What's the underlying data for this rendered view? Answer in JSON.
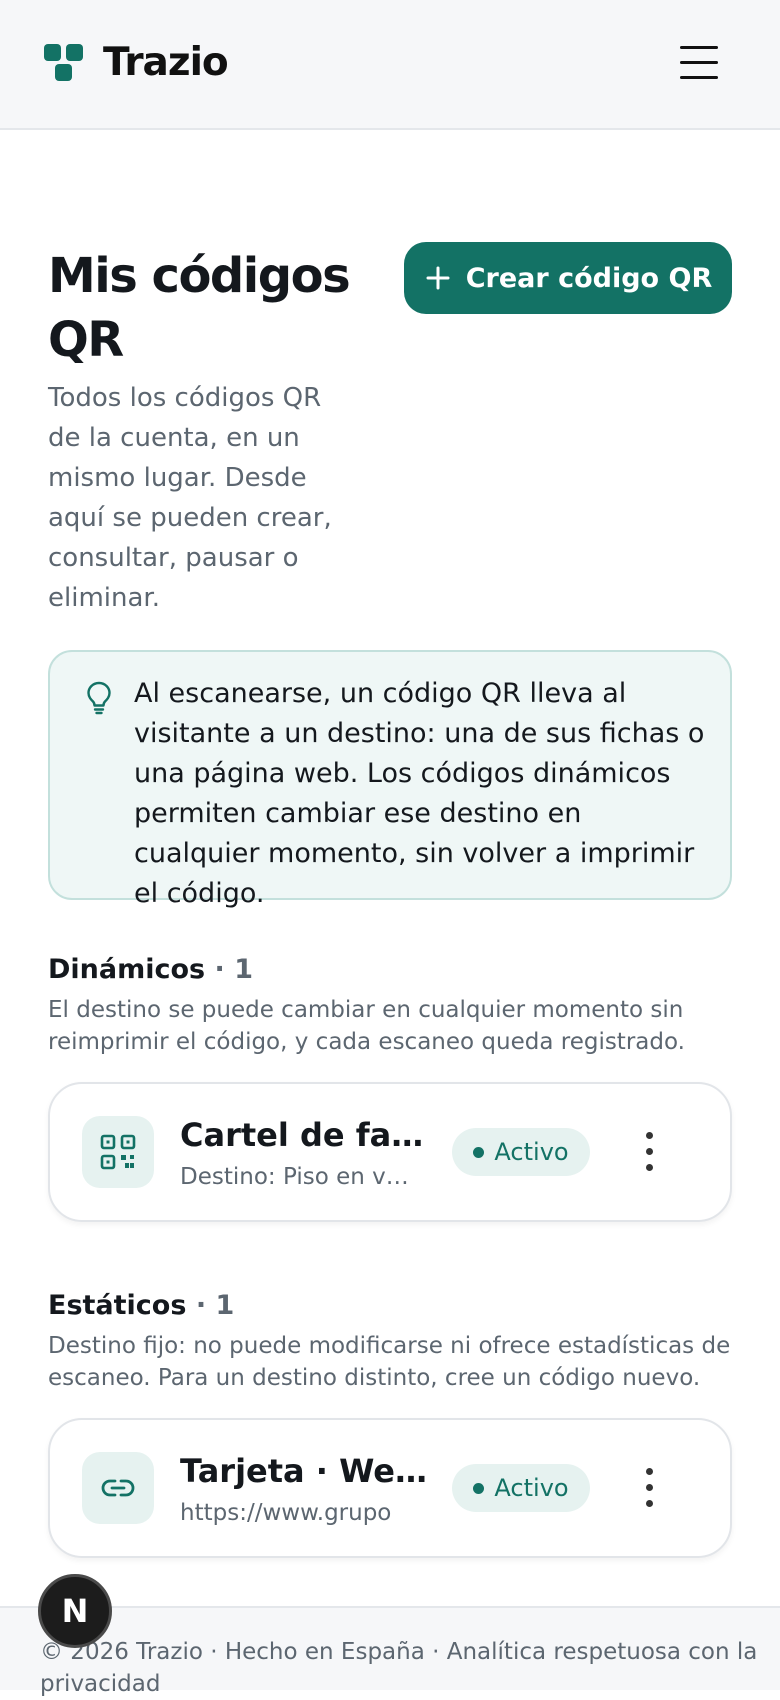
{
  "app": {
    "name": "Trazio",
    "brand_color": "#137265",
    "logo_icon": "brand-logo-icon",
    "menu_icon": "hamburger-menu-icon"
  },
  "page": {
    "title": "Mis códigos QR",
    "description": "Todos los códigos QR de la cuenta, en un mismo lugar. Desde aquí se pueden crear, consultar, pausar o eliminar.",
    "create_button": {
      "icon": "plus-icon",
      "label": "Crear código QR"
    }
  },
  "info": {
    "icon": "lightbulb-icon",
    "text": "Al escanearse, un código QR lleva al visitante a un destino: una de sus fichas o una página web. Los códigos dinámicos permiten cambiar ese destino en cualquier momento, sin volver a imprimir el código."
  },
  "sections": [
    {
      "title": "Dinámicos",
      "count": "· 1",
      "description": "El destino se puede cambiar en cualquier momento sin reimprimir el código, y cada escaneo queda registrado.",
      "items": [
        {
          "icon": "qr-code-icon",
          "title": "Cartel de fachada",
          "subtitle": "Destino: Piso en venta",
          "status": "Activo"
        }
      ]
    },
    {
      "title": "Estáticos",
      "count": "· 1",
      "description": "Destino fijo: no puede modificarse ni ofrece estadísticas de escaneo. Para un destino distinto, cree un código nuevo.",
      "items": [
        {
          "icon": "link-icon",
          "title": "Tarjeta · Web corporativa",
          "subtitle": "https://www.grupo",
          "status": "Activo"
        }
      ]
    }
  ],
  "footer": {
    "text": "© 2026 Trazio · Hecho en España · Analítica respetuosa con la privacidad"
  },
  "dev_badge": {
    "label": "N"
  }
}
